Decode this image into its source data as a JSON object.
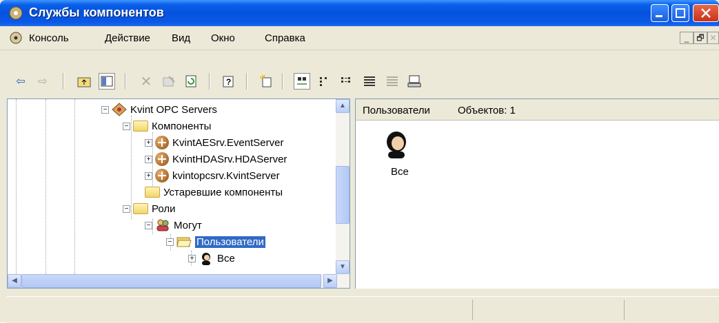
{
  "window": {
    "title": "Службы компонентов"
  },
  "menu": [
    "Консоль",
    "Действие",
    "Вид",
    "Окно",
    "Справка"
  ],
  "mdi_controls": [
    "_",
    "🗗",
    "✕"
  ],
  "toolbar": {
    "icons": [
      "back-icon",
      "forward-icon",
      "up-folder-icon",
      "show-hide-tree-icon",
      "delete-icon",
      "properties-icon",
      "refresh-icon",
      "help-icon",
      "new-object-icon",
      "large-icons-view-icon",
      "small-icons-view-icon",
      "list-view-icon",
      "details-view-icon",
      "status-view-icon",
      "computer-icon"
    ]
  },
  "tree": {
    "items": [
      {
        "label": "Kvint OPC Servers"
      },
      {
        "label": "Компоненты"
      },
      {
        "label": "KvintAESrv.EventServer"
      },
      {
        "label": "KvintHDASrv.HDAServer"
      },
      {
        "label": "kvintopcsrv.KvintServer"
      },
      {
        "label": "Устаревшие компоненты"
      },
      {
        "label": "Роли"
      },
      {
        "label": "Могут"
      },
      {
        "label": "Пользователи"
      },
      {
        "label": "Все"
      }
    ]
  },
  "right_pane": {
    "header_title": "Пользователи",
    "header_count": "Объектов: 1",
    "items": [
      {
        "label": "Все"
      }
    ]
  }
}
